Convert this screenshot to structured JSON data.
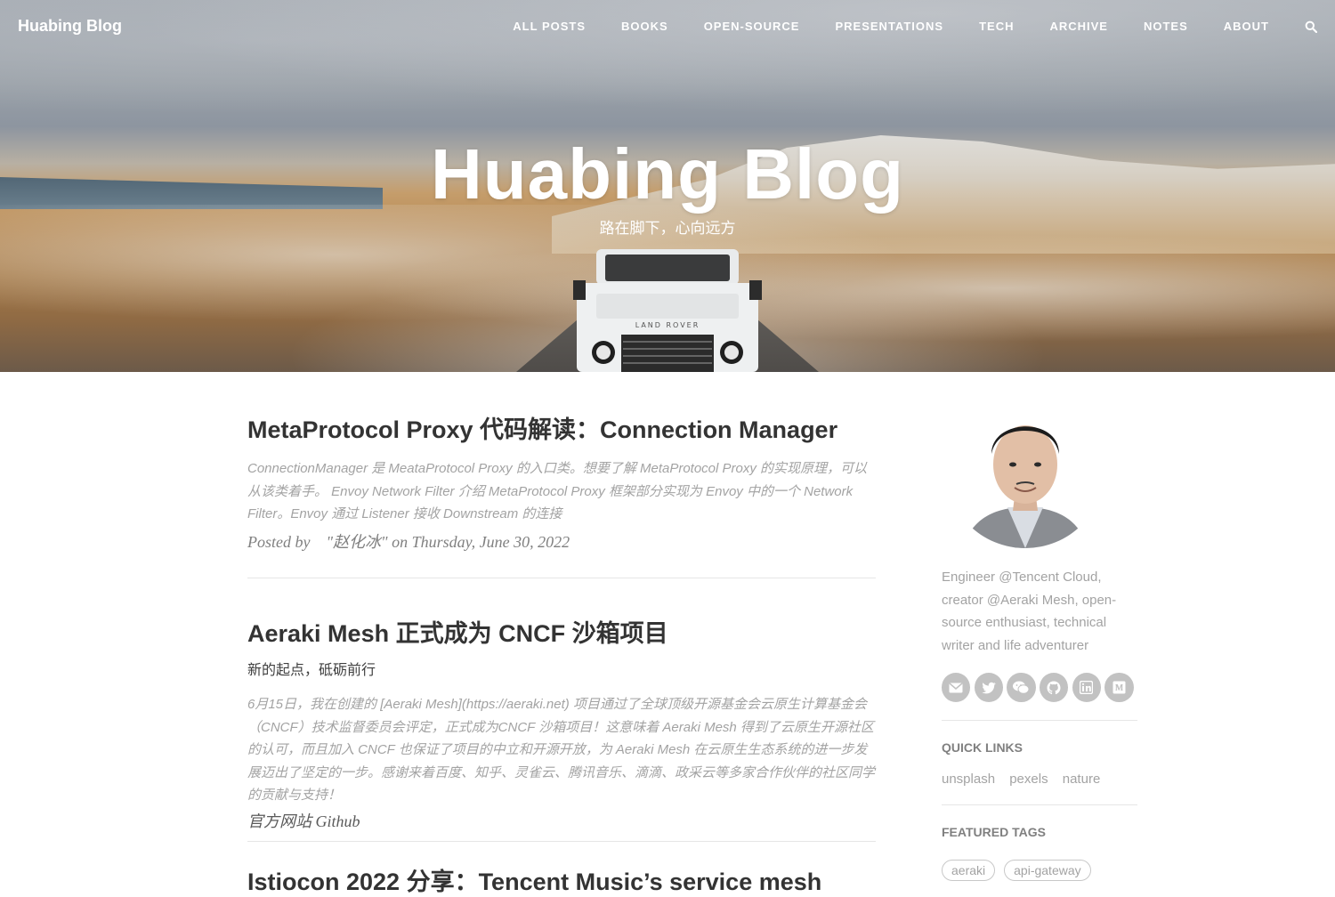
{
  "header": {
    "brand": "Huabing Blog",
    "nav": [
      "ALL POSTS",
      "BOOKS",
      "OPEN-SOURCE",
      "PRESENTATIONS",
      "TECH",
      "ARCHIVE",
      "NOTES",
      "ABOUT"
    ],
    "search_icon": "search-icon"
  },
  "hero": {
    "title": "Huabing Blog",
    "subtitle": "路在脚下，心向远方",
    "car_badge": "LAND ROVER"
  },
  "posts": [
    {
      "title": "MetaProtocol Proxy 代码解读：Connection Manager",
      "excerpt": "ConnectionManager 是 MeataProtocol Proxy 的入口类。想要了解 MetaProtocol Proxy 的实现原理，可以从该类着手。 Envoy Network Filter 介绍 MetaProtocol Proxy 框架部分实现为 Envoy 中的一个 Network Filter。Envoy 通过 Listener 接收 Downstream 的连接",
      "meta_prefix": "Posted by",
      "meta_author": "\"赵化冰\" on Thursday, June 30, 2022"
    },
    {
      "title": "Aeraki Mesh 正式成为 CNCF 沙箱项目",
      "subtitle": "新的起点，砥砺前行",
      "excerpt": "6月15日，我在创建的 [Aeraki Mesh](https://aeraki.net) 项目通过了全球顶级开源基金会云原生计算基金会（CNCF）技术监督委员会评定，正式成为CNCF 沙箱项目！这意味着 Aeraki Mesh 得到了云原生开源社区的认可，而且加入 CNCF 也保证了项目的中立和开源开放，为 Aeraki Mesh 在云原生生态系统的进一步发展迈出了坚定的一步。感谢来着百度、知乎、灵雀云、腾讯音乐、滴滴、政采云等多家合作伙伴的社区同学的贡献与支持！",
      "links": [
        "官方网站",
        "Github"
      ]
    },
    {
      "title": "Istiocon 2022 分享：Tencent Music’s service mesh"
    }
  ],
  "sidebar": {
    "bio": "Engineer @Tencent Cloud, creator @Aeraki Mesh, open-source enthusiast, technical writer and life adventurer",
    "social_icons": [
      "email-icon",
      "twitter-icon",
      "wechat-icon",
      "github-icon",
      "linkedin-icon",
      "medium-icon"
    ],
    "quick_links_heading": "QUICK LINKS",
    "quick_links": [
      "unsplash",
      "pexels",
      "nature"
    ],
    "featured_tags_heading": "FEATURED TAGS",
    "featured_tags": [
      "aeraki",
      "api-gateway"
    ]
  }
}
